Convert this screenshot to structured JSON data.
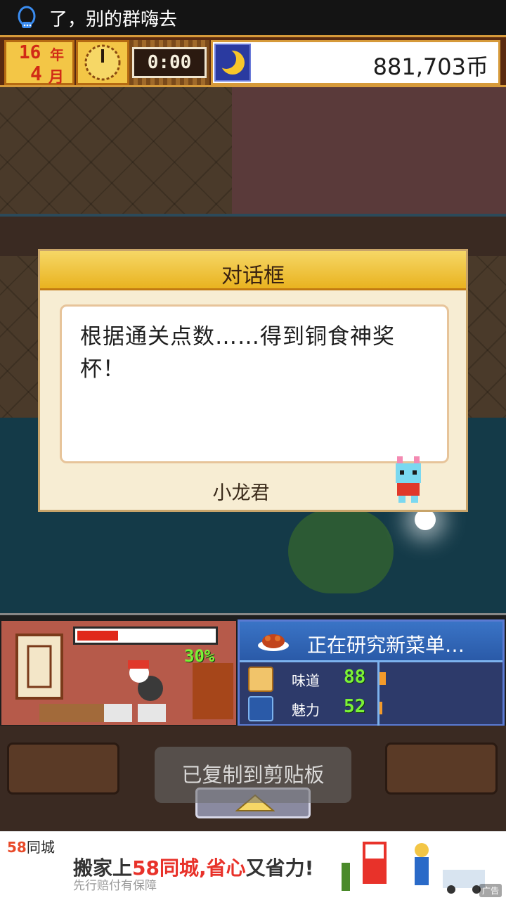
{
  "status_bar": {
    "notification_text": "了，别的群嗨去"
  },
  "hud": {
    "year_value": "16",
    "year_unit": "年",
    "month_value": "4",
    "month_unit": "月",
    "time": "0:00",
    "money": "881,703币"
  },
  "dialog": {
    "title": "对话框",
    "message": "根据通关点数……得到铜食神奖杯！",
    "speaker": "小龙君"
  },
  "kitchen": {
    "progress_percent": 30,
    "progress_label": "30%",
    "research_title": "正在研究新菜单…",
    "stats": [
      {
        "label": "味道",
        "value": "88",
        "icon": "taste-face-icon"
      },
      {
        "label": "魅力",
        "value": "52",
        "icon": "charm-dish-icon"
      }
    ]
  },
  "controls": {
    "toast": "已复制到剪贴板"
  },
  "ad": {
    "brand_number": "58",
    "brand_text": "同城",
    "headline_prefix": "搬家上",
    "headline_highlight": "58同城,省心",
    "headline_suffix": "又省力!",
    "sub": "先行赔付有保障",
    "tag": "广告"
  },
  "colors": {
    "accent_gold": "#f3c646",
    "progress_red": "#e0281a",
    "stat_green": "#7cf236",
    "research_blue": "#3a74c6"
  }
}
